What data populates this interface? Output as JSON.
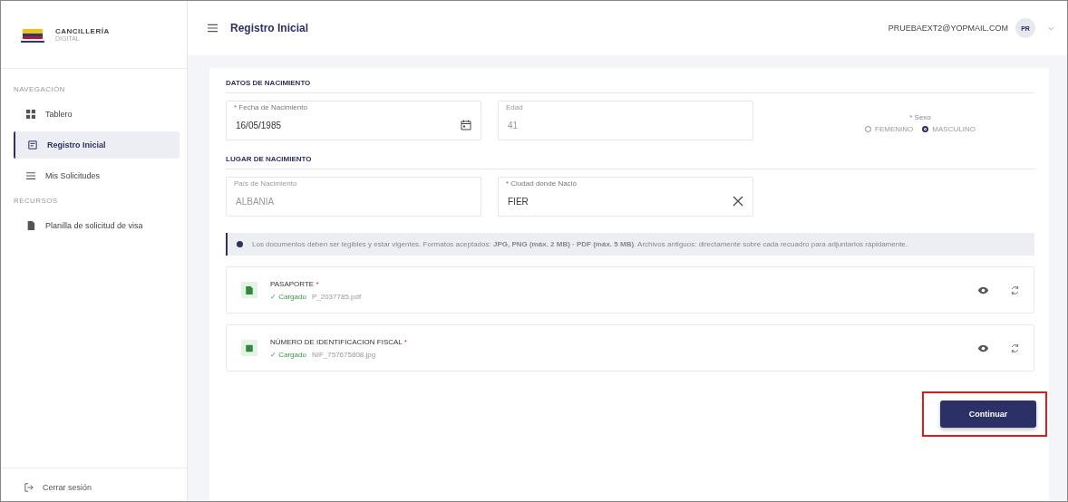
{
  "brand": {
    "name": "CANCILLERÍA",
    "sub": "DIGITAL"
  },
  "sidebar": {
    "sections": [
      {
        "title": "NAVEGACIÓN",
        "items": [
          {
            "label": "Tablero",
            "selected": false
          },
          {
            "label": "Registro Inicial",
            "selected": true
          },
          {
            "label": "Mis Solicitudes",
            "selected": false
          }
        ]
      },
      {
        "title": "RECURSOS",
        "items": [
          {
            "label": "Planilla de solicitud de visa",
            "selected": false
          }
        ]
      }
    ],
    "logout": "Cerrar sesión"
  },
  "header": {
    "title": "Registro Inicial",
    "email": "PRUEBAEXT2@YOPMAIL.COM",
    "initials": "PR"
  },
  "birth": {
    "title": "DATOS DE NACIMIENTO",
    "fields": [
      {
        "label": "* Fecha de Nacimiento",
        "value": "16/05/1985",
        "disabled": false
      },
      {
        "label": "Edad",
        "value": "41",
        "disabled": true
      }
    ],
    "sex": {
      "label": "* Sexo",
      "options": [
        {
          "label": "FEMENINO",
          "selected": false
        },
        {
          "label": "MASCULINO",
          "selected": true
        }
      ]
    }
  },
  "place": {
    "title": "LUGAR DE NACIMIENTO",
    "fields": [
      {
        "label": "País de Nacimiento",
        "value": "ALBANIA",
        "disabled": true
      },
      {
        "label": "* Ciudad donde Nació",
        "value": "FIER",
        "disabled": false
      }
    ]
  },
  "info": "Los documentos deben ser legibles y estar vigentes. Formatos aceptados: **JPG, PNG (máx. 2 MB) · PDF (máx. 5 MB)**. Archivos antiguos: directamente sobre cada recuadro para adjuntarlos rápidamente.",
  "documents": [
    {
      "title": "PASAPORTE",
      "required": "*",
      "status": "✓ Cargado",
      "file": "P_2037785.pdf"
    },
    {
      "title": "NÚMERO DE IDENTIFICACION FISCAL",
      "required": "*",
      "status": "✓ Cargado",
      "file": "NIF_757675808.jpg"
    }
  ],
  "continue": "Continuar"
}
